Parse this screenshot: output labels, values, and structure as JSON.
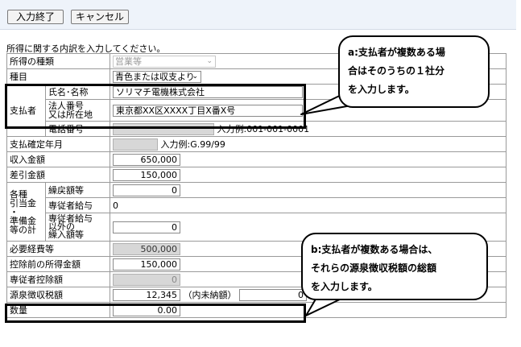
{
  "toolbar": {
    "finish_label": "入力終了",
    "cancel_label": "キャンセル"
  },
  "intro": "所得に関する内訳を入力してください。",
  "rows": {
    "income_type": {
      "label": "所得の種類",
      "value": "営業等"
    },
    "category": {
      "label": "種目",
      "value": "青色または収支より"
    },
    "payer": {
      "label": "支払者",
      "name_label": "氏名･名称",
      "name_value": "ソリマチ電機株式会社",
      "corp_label_line1": "法人番号",
      "corp_label_line2": "又は所在地",
      "corp_value": "東京都XX区XXXX丁目X番X号",
      "phone_label": "電話番号",
      "phone_hint": "入力例:001-001-0001"
    },
    "payment_date": {
      "label": "支払確定年月",
      "hint": "入力例:G.99/99"
    },
    "revenue": {
      "label": "収入金額",
      "value": "650,000"
    },
    "difference": {
      "label": "差引金額",
      "value": "150,000"
    },
    "reserves": {
      "label_line1": "各種",
      "label_line2": "引当金",
      "label_line3": "・",
      "label_line4": "準備金",
      "label_line5": "等の計",
      "transfer_label": "繰戻額等",
      "transfer_value": "0",
      "salary_label": "専従者給与",
      "salary_value": "0",
      "other_label_line1": "専従者給与",
      "other_label_line2": "以外の",
      "other_label_line3": "繰入額等",
      "other_value": "0"
    },
    "expenses": {
      "label": "必要経費等",
      "value": "500,000"
    },
    "pre_deduction": {
      "label": "控除前の所得金額",
      "value": "150,000"
    },
    "family_deduction": {
      "label": "専従者控除額",
      "value": "0"
    },
    "withholding": {
      "label": "源泉徴収税額",
      "value": "12,345",
      "unpaid_label": "（内未納額）",
      "unpaid_value": "0"
    },
    "quantity": {
      "label": "数量",
      "value": "0.00"
    }
  },
  "callouts": {
    "a": {
      "line1": "a:支払者が複数ある場",
      "line2": "合はそのうちの１社分",
      "line3": "を入力します。"
    },
    "b": {
      "line1": "b:支払者が複数ある場合は、",
      "line2": "それらの源泉徴収税額の総額",
      "line3": "を入力します。"
    }
  }
}
